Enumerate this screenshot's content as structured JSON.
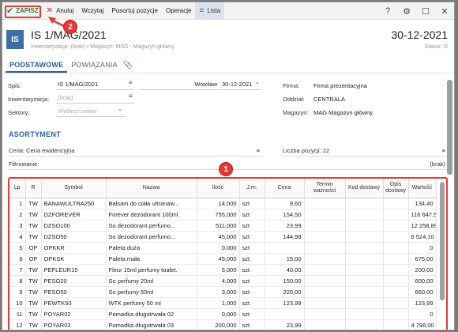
{
  "toolbar": {
    "save": "ZAPISZ",
    "cancel": "Anuluj",
    "load": "Wczytaj",
    "sort": "Posortuj pozycje",
    "operations": "Operacje",
    "list": "Lista",
    "help": "?",
    "settings": "⚙",
    "maximize": "☐",
    "close": "✕"
  },
  "header": {
    "badge": "IS",
    "title": "IS 1/MAG/2021",
    "subtitle": "Inwentaryzacja: (brak)  •  Magazyn: MAG - Magazyn główny",
    "date": "30-12-2021",
    "status": "Status: O"
  },
  "tabs": [
    "PODSTAWOWE",
    "POWIĄZANIA"
  ],
  "form": {
    "spis_label": "Spis:",
    "spis_value": "IS 1/MAG/2021",
    "city_value": "Wrocław",
    "date_value": "30-12-2021",
    "inw_label": "Inwentaryzacja:",
    "inw_placeholder": "(brak)",
    "sektory_label": "Sektory:",
    "sektory_placeholder": "Wybierz sektor",
    "firma_label": "Firma:",
    "firma_value": "Firma prezentacyjna",
    "oddzial_label": "Oddział:",
    "oddzial_value": "CENTRALA",
    "magazyn_label": "Magazyn:",
    "magazyn_value": "MAG Magazyn główny"
  },
  "section": {
    "title": "ASORTYMENT",
    "cena_label": "Cena: Cena ewidencyjna",
    "liczba_label": "Liczba pozycji: 22",
    "filtr_label": "Filtrowanie:",
    "filtr_value": "(brak)"
  },
  "table": {
    "headers": [
      "Lp",
      "R",
      "Symbol",
      "Nazwa",
      "Ilość",
      "J.m.",
      "Cena",
      "Termin ważności",
      "Kod dostawy",
      "Opis dostawy",
      "Wartość"
    ],
    "rows": [
      [
        "1",
        "TW",
        "BANAWULTRA250",
        "Balsam do ciała ultranaw...",
        "14,000",
        "szt",
        "9,60",
        "",
        "",
        "",
        "134,40"
      ],
      [
        "2",
        "TW",
        "DZFOREVER",
        "Forever dezodorant 100ml",
        "755,000",
        "szt",
        "154,50",
        "",
        "",
        "",
        "116 647,50"
      ],
      [
        "3",
        "TW",
        "DZSO100",
        "So dezodorant perfumo...",
        "511,000",
        "szt",
        "23,99",
        "",
        "",
        "",
        "12 258,89"
      ],
      [
        "4",
        "TW",
        "DZSO50",
        "So dezodorant perfumo...",
        "45,000",
        "szt",
        "144,98",
        "",
        "",
        "",
        "6 524,10"
      ],
      [
        "5",
        "OP",
        "OPKKR",
        "Paleta duża",
        "0,000",
        "szt",
        "",
        "",
        "",
        "",
        "0"
      ],
      [
        "6",
        "OP",
        "OPKSK",
        "Paleta mała",
        "45,000",
        "szt",
        "15,00",
        "",
        "",
        "",
        "675,00"
      ],
      [
        "7",
        "TW",
        "PEFLEUR15",
        "Fleur 15ml perfumy toalet.",
        "5,000",
        "szt",
        "40,00",
        "",
        "",
        "",
        "200,00"
      ],
      [
        "8",
        "TW",
        "PESO20",
        "So perfumy 20ml",
        "4,000",
        "szt",
        "150,00",
        "",
        "",
        "",
        "600,00"
      ],
      [
        "9",
        "TW",
        "PESO50",
        "So perfumy 50ml",
        "3,000",
        "szt",
        "220,00",
        "",
        "",
        "",
        "660,00"
      ],
      [
        "10",
        "TW",
        "PEWTK50",
        "WTK perfumy 50 ml",
        "1,000",
        "szt",
        "123,99",
        "",
        "",
        "",
        "123,99"
      ],
      [
        "11",
        "TW",
        "POYAR02",
        "Pomadka długotrwała 02",
        "0,000",
        "szt",
        "",
        "",
        "",
        "",
        "0"
      ],
      [
        "12",
        "TW",
        "POYAR03",
        "Pomadka długotrwała 03",
        "200,000",
        "szt",
        "23,99",
        "",
        "",
        "",
        "4 798,00"
      ]
    ]
  },
  "callouts": [
    "1",
    "2"
  ],
  "colors": {
    "accent": "#2b5da1",
    "save": "#2e7d32",
    "highlight": "#e53935"
  }
}
